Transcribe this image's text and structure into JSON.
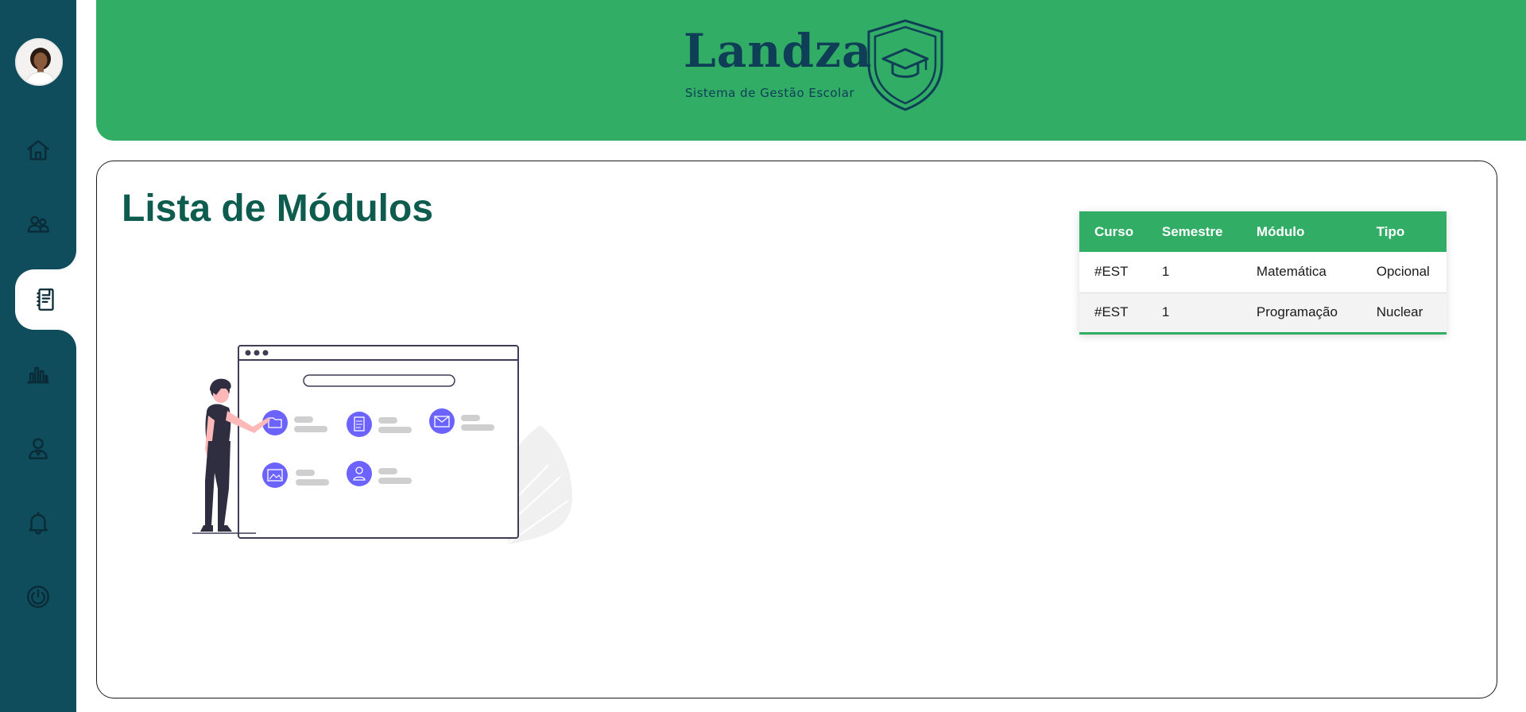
{
  "brand": {
    "name": "Landza",
    "subtitle": "Sistema de Gestão Escolar"
  },
  "sidebar": {
    "items": [
      {
        "name": "home",
        "icon": "home-icon"
      },
      {
        "name": "users",
        "icon": "users-icon"
      },
      {
        "name": "modules",
        "icon": "notebook-icon",
        "active": true
      },
      {
        "name": "reports",
        "icon": "bar-chart-icon"
      },
      {
        "name": "teacher",
        "icon": "user-icon"
      },
      {
        "name": "notifications",
        "icon": "bell-icon"
      },
      {
        "name": "logout",
        "icon": "power-icon"
      }
    ]
  },
  "main": {
    "title": "Lista de Módulos",
    "table": {
      "headers": [
        "Curso",
        "Semestre",
        "Módulo",
        "Tipo"
      ],
      "rows": [
        [
          "#EST",
          "1",
          "Matemática",
          "Opcional"
        ],
        [
          "#EST",
          "1",
          "Programação",
          "Nuclear"
        ]
      ]
    }
  },
  "colors": {
    "sidebar": "#0f4c5c",
    "header": "#31ad65",
    "title": "#0d5c4e",
    "brand": "#0f3e57",
    "accent_illustration": "#6c63ff"
  }
}
